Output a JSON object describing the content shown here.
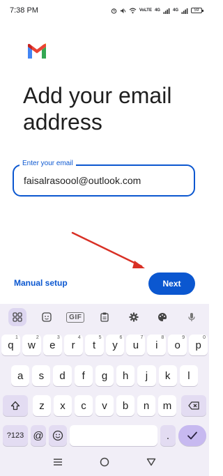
{
  "status_bar": {
    "time": "7:38 PM",
    "network_1": "4G",
    "network_2": "4G",
    "battery": "59"
  },
  "logo": {
    "name": "gmail-logo",
    "colors": [
      "#4285F4",
      "#EA4335",
      "#FBBC04",
      "#34A853",
      "#C5221F"
    ]
  },
  "headline": "Add your email address",
  "email": {
    "label": "Enter your email",
    "value": "faisalrasoool@outlook.com"
  },
  "annotation": {
    "color": "#d93025"
  },
  "actions": {
    "manual_setup": "Manual setup",
    "next": "Next"
  },
  "keyboard": {
    "toolbar": [
      {
        "name": "apps-grid-icon",
        "glyph": "⊞"
      },
      {
        "name": "sticker-icon",
        "glyph": "☺"
      },
      {
        "name": "gif-button",
        "glyph": "GIF"
      },
      {
        "name": "clipboard-icon",
        "glyph": "📋"
      },
      {
        "name": "settings-icon",
        "glyph": "⚙"
      },
      {
        "name": "palette-icon",
        "glyph": "🎨"
      },
      {
        "name": "microphone-icon",
        "glyph": "🎤"
      }
    ],
    "row1": [
      {
        "k": "q",
        "h": "1"
      },
      {
        "k": "w",
        "h": "2"
      },
      {
        "k": "e",
        "h": "3"
      },
      {
        "k": "r",
        "h": "4"
      },
      {
        "k": "t",
        "h": "5"
      },
      {
        "k": "y",
        "h": "6"
      },
      {
        "k": "u",
        "h": "7"
      },
      {
        "k": "i",
        "h": "8"
      },
      {
        "k": "o",
        "h": "9"
      },
      {
        "k": "p",
        "h": "0"
      }
    ],
    "row2": [
      "a",
      "s",
      "d",
      "f",
      "g",
      "h",
      "j",
      "k",
      "l"
    ],
    "row3": [
      "z",
      "x",
      "c",
      "v",
      "b",
      "n",
      "m"
    ],
    "symbols_key": "?123",
    "at_key": "@",
    "dot_key": "."
  },
  "nav": {
    "recents": "recents-icon",
    "home": "home-icon",
    "back": "back-icon"
  },
  "colors": {
    "accent": "#0b57d0",
    "keyboard_bg": "#f1eef7",
    "enter_key": "#c7b9f0"
  }
}
